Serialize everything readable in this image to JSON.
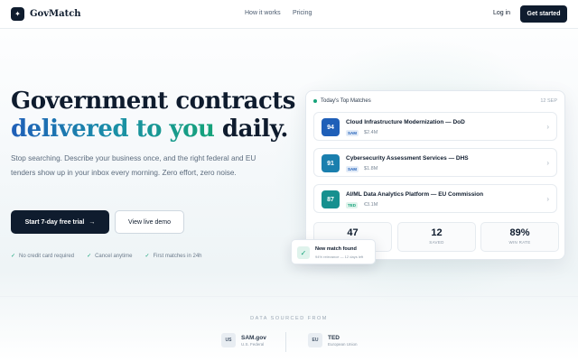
{
  "brand": {
    "name": "GovMatch",
    "mark": "✦"
  },
  "nav": {
    "items": [
      "How it works",
      "Pricing"
    ],
    "login": "Log in",
    "cta": "Get started"
  },
  "hero": {
    "line1": "Government contracts",
    "line2_gradient": "delivered to you",
    "line2_rest": " daily.",
    "subtitle": "Stop searching. Describe your business once, and the right federal and EU tenders show up in your inbox every morning. Zero effort, zero noise.",
    "primary_cta": "Start 7-day free trial",
    "primary_cta_icon": "→",
    "secondary_cta": "View live demo",
    "checks": [
      "No credit card required",
      "Cancel anytime",
      "First matches in 24h"
    ]
  },
  "matches_card": {
    "title": "Today's Top Matches",
    "date": "12 SEP",
    "rows": [
      {
        "score": "94",
        "title": "Cloud Infrastructure Modernization — DoD",
        "tag": "SAM",
        "amount": "$2.4M",
        "score_color": "#1f5fb8",
        "tag_bg": "#e3ecf8",
        "tag_color": "#1f5fb8"
      },
      {
        "score": "91",
        "title": "Cybersecurity Assessment Services — DHS",
        "tag": "SAM",
        "amount": "$1.8M",
        "score_color": "#1a7fae",
        "tag_bg": "#e3ecf8",
        "tag_color": "#1f5fb8"
      },
      {
        "score": "87",
        "title": "AI/ML Data Analytics Platform — EU Commission",
        "tag": "TED",
        "amount": "€3.1M",
        "score_color": "#16908f",
        "tag_bg": "#dff3ec",
        "tag_color": "#16a37a"
      }
    ],
    "stats": [
      {
        "value": "47",
        "label": "MATCHED"
      },
      {
        "value": "12",
        "label": "SAVED"
      },
      {
        "value": "89%",
        "label": "WIN RATE"
      }
    ]
  },
  "toast": {
    "title": "New match found",
    "subtitle": "94% relevance — 12 days left",
    "icon": "✓"
  },
  "sources": {
    "label": "DATA SOURCED FROM",
    "items": [
      {
        "badge": "US",
        "name": "SAM.gov",
        "desc": "U.S. Federal"
      },
      {
        "badge": "EU",
        "name": "TED",
        "desc": "European Union"
      }
    ]
  }
}
